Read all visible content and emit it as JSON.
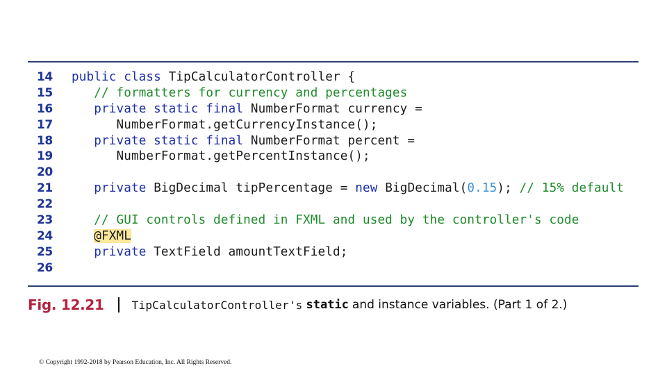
{
  "code_listing": {
    "lines": [
      {
        "number": "14",
        "tokens": [
          {
            "t": "public class ",
            "c": "kw"
          },
          {
            "t": "TipCalculatorController {",
            "c": "plain"
          }
        ]
      },
      {
        "number": "15",
        "tokens": [
          {
            "t": "   ",
            "c": "plain"
          },
          {
            "t": "// formatters for currency and percentages",
            "c": "cm"
          }
        ]
      },
      {
        "number": "16",
        "tokens": [
          {
            "t": "   ",
            "c": "plain"
          },
          {
            "t": "private static final ",
            "c": "kw"
          },
          {
            "t": "NumberFormat currency =",
            "c": "plain"
          }
        ]
      },
      {
        "number": "17",
        "tokens": [
          {
            "t": "      NumberFormat.getCurrencyInstance();",
            "c": "plain"
          }
        ]
      },
      {
        "number": "18",
        "tokens": [
          {
            "t": "   ",
            "c": "plain"
          },
          {
            "t": "private static final ",
            "c": "kw"
          },
          {
            "t": "NumberFormat percent =",
            "c": "plain"
          }
        ]
      },
      {
        "number": "19",
        "tokens": [
          {
            "t": "      NumberFormat.getPercentInstance();",
            "c": "plain"
          }
        ]
      },
      {
        "number": "20",
        "tokens": []
      },
      {
        "number": "21",
        "tokens": [
          {
            "t": "   ",
            "c": "plain"
          },
          {
            "t": "private ",
            "c": "kw"
          },
          {
            "t": "BigDecimal tipPercentage = ",
            "c": "plain"
          },
          {
            "t": "new ",
            "c": "kw"
          },
          {
            "t": "BigDecimal(",
            "c": "plain"
          },
          {
            "t": "0.15",
            "c": "num"
          },
          {
            "t": "); ",
            "c": "plain"
          },
          {
            "t": "// 15% default",
            "c": "cm"
          }
        ]
      },
      {
        "number": "22",
        "tokens": []
      },
      {
        "number": "23",
        "tokens": [
          {
            "t": "   ",
            "c": "plain"
          },
          {
            "t": "// GUI controls defined in FXML and used by the controller's code",
            "c": "cm"
          }
        ]
      },
      {
        "number": "24",
        "tokens": [
          {
            "t": "   ",
            "c": "plain"
          },
          {
            "t": "@FXML",
            "c": "ann"
          }
        ]
      },
      {
        "number": "25",
        "tokens": [
          {
            "t": "   ",
            "c": "plain"
          },
          {
            "t": "private ",
            "c": "kw"
          },
          {
            "t": "TextField amountTextField;",
            "c": "plain"
          }
        ]
      },
      {
        "number": "26",
        "tokens": []
      }
    ]
  },
  "caption": {
    "label": "Fig. 12.21",
    "class_name": "TipCalculatorController's",
    "keyword": "static",
    "text": "and instance variables. (Part 1 of 2.)"
  },
  "footer": {
    "copyright": "© Copyright 1992-2018 by Pearson Education, Inc. All Rights Reserved."
  },
  "colors": {
    "keyword": "#1c2dab",
    "comment": "#1e8a2a",
    "number_literal": "#3d8ed8",
    "annotation_highlight": "#fce89a",
    "line_number": "#1f3596",
    "figure_label": "#b5223f",
    "rule": "#2c3e74"
  }
}
